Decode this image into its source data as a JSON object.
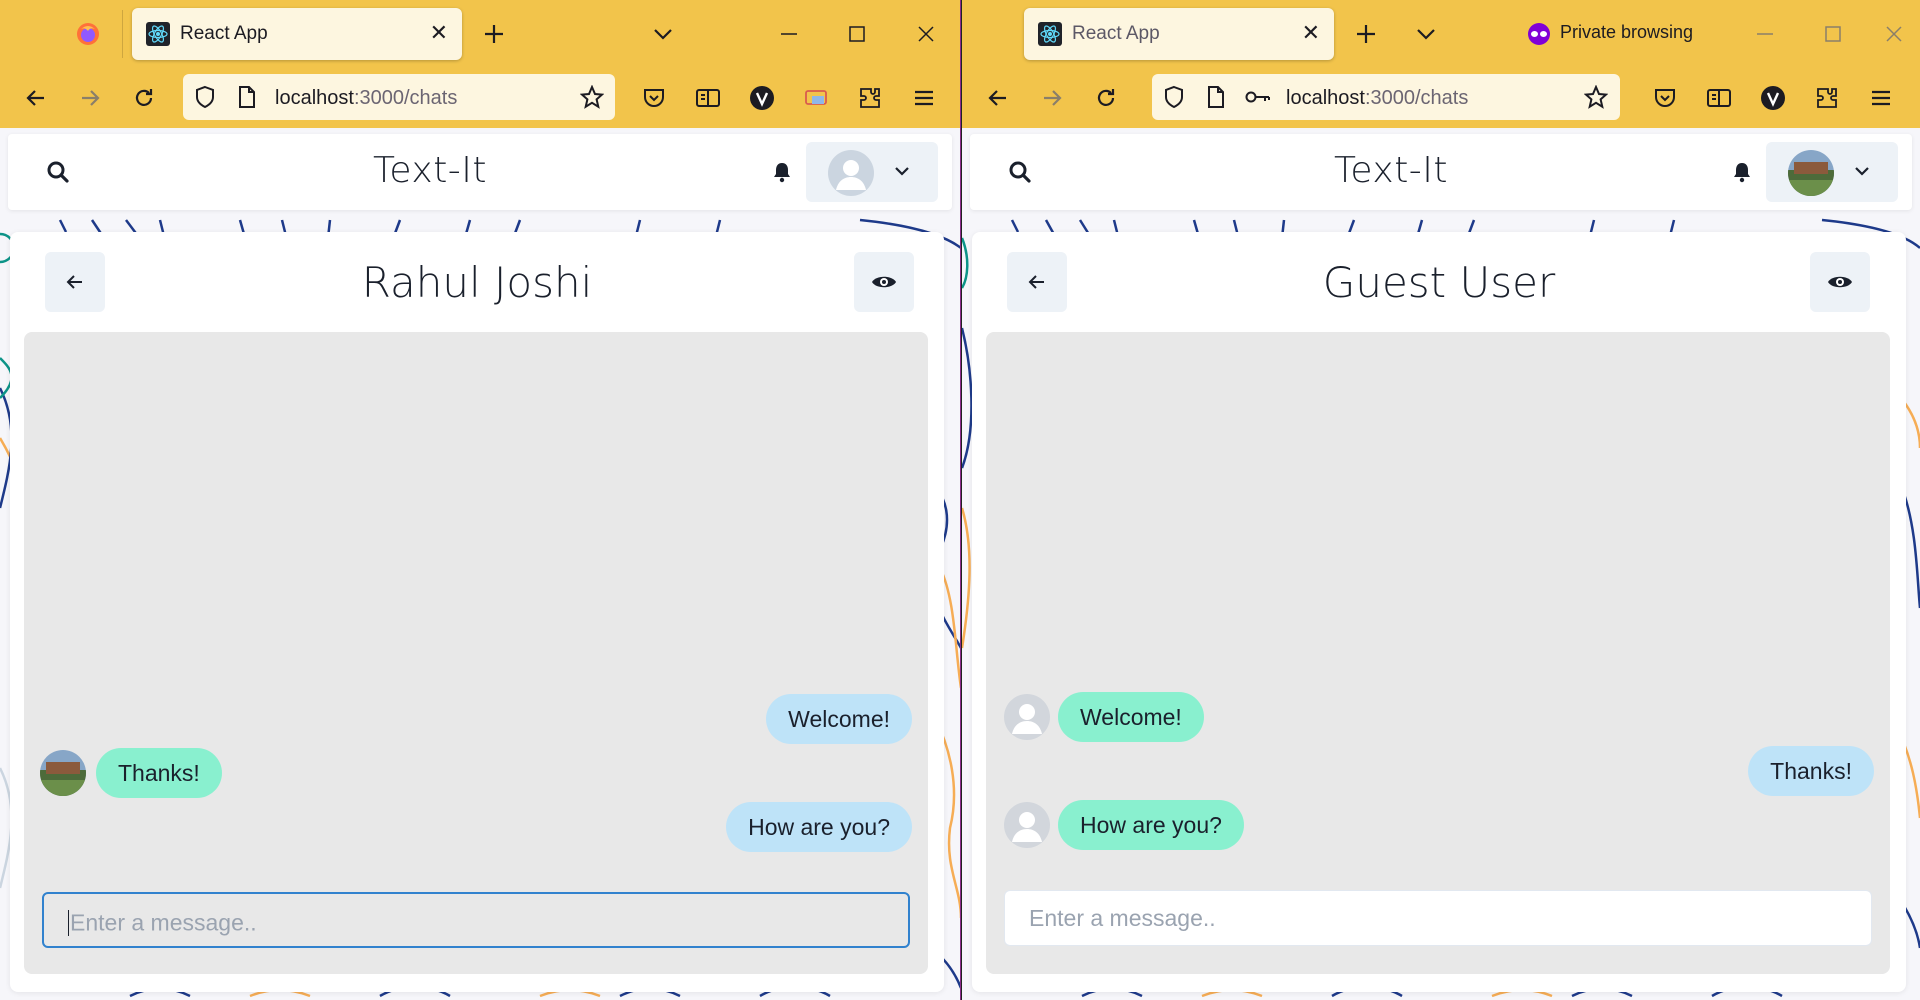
{
  "left": {
    "tab_title": "React App",
    "url_host": "localhost",
    "url_path": ":3000/chats",
    "app_title": "Text-It",
    "chat_name": "Rahul Joshi",
    "messages": [
      {
        "text": "Welcome!",
        "side": "right"
      },
      {
        "text": "Thanks!",
        "side": "left"
      },
      {
        "text": "How are you?",
        "side": "right"
      }
    ],
    "input_placeholder": "Enter a message.."
  },
  "right": {
    "tab_title": "React App",
    "private_label": "Private browsing",
    "url_host": "localhost",
    "url_path": ":3000/chats",
    "app_title": "Text-It",
    "chat_name": "Guest User",
    "messages": [
      {
        "text": "Welcome!",
        "side": "left"
      },
      {
        "text": "Thanks!",
        "side": "right"
      },
      {
        "text": "How are you?",
        "side": "left"
      }
    ],
    "input_placeholder": "Enter a message.."
  },
  "colors": {
    "chrome": "#f2c44b",
    "sent_bubble": "#bee3f8",
    "received_bubble": "#89f0cf",
    "focus_ring": "#3182ce"
  },
  "icons": [
    "firefox-icon",
    "react-icon",
    "close-icon",
    "plus-icon",
    "chevron-down-icon",
    "minimize-icon",
    "maximize-icon",
    "back-icon",
    "forward-icon",
    "reload-icon",
    "shield-icon",
    "page-icon",
    "key-icon",
    "star-icon",
    "pocket-icon",
    "reader-icon",
    "vpn-icon",
    "extensions-icon",
    "menu-icon",
    "search-icon",
    "bell-icon",
    "eye-icon",
    "arrow-left-icon",
    "user-placeholder-icon",
    "private-mask-icon"
  ]
}
